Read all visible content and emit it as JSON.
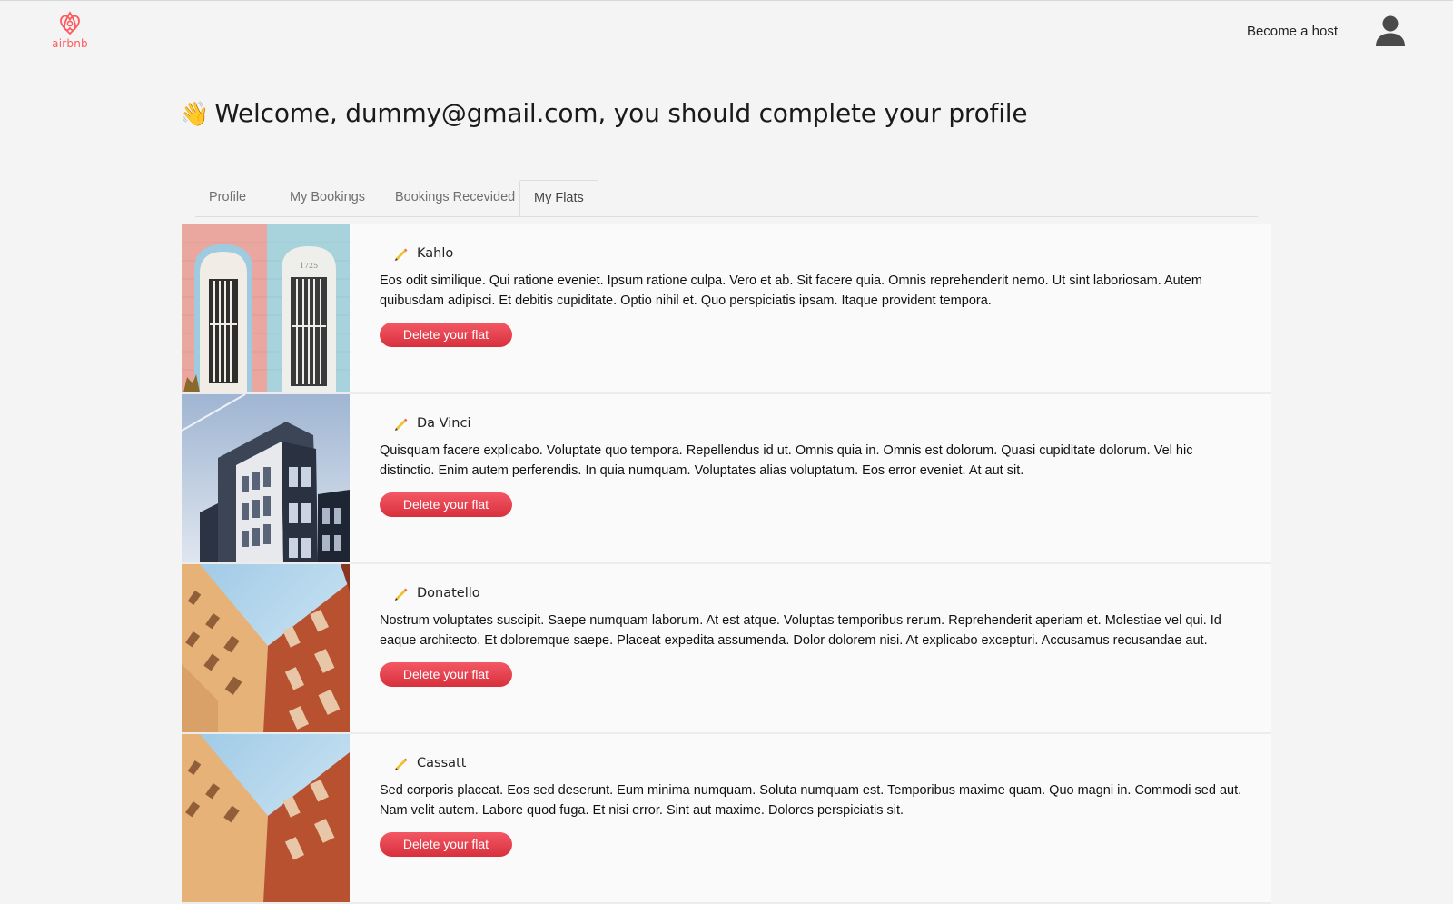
{
  "header": {
    "logo_text": "airbnb",
    "become_host": "Become a host",
    "brand_color": "#ff5a5f"
  },
  "welcome": {
    "emoji": "👋",
    "text": "Welcome, dummy@gmail.com, you should complete your profile"
  },
  "tabs": [
    {
      "label": "Profile",
      "active": false
    },
    {
      "label": "My Bookings",
      "active": false
    },
    {
      "label": "Bookings Recevided",
      "active": false
    },
    {
      "label": "My Flats",
      "active": true
    }
  ],
  "flats": [
    {
      "title": "Kahlo",
      "description": "Eos odit similique. Qui ratione eveniet. Ipsum ratione culpa. Vero et ab. Sit facere quia. Omnis reprehenderit nemo. Ut sint laboriosam. Autem quibusdam adipisci. Et debitis cupiditate. Optio nihil et. Quo perspiciatis ipsam. Itaque provident tempora.",
      "button": "Delete your flat",
      "image": "pastel-doors"
    },
    {
      "title": "Da Vinci",
      "description": "Quisquam facere explicabo. Voluptate quo tempora. Repellendus id ut. Omnis quia in. Omnis est dolorum. Quasi cupiditate dolorum. Vel hic distinctio. Enim autem perferendis. In quia numquam. Voluptates alias voluptatum. Eos error eveniet. At aut sit.",
      "button": "Delete your flat",
      "image": "modern-building"
    },
    {
      "title": "Donatello",
      "description": "Nostrum voluptates suscipit. Saepe numquam laborum. At est atque. Voluptas temporibus rerum. Reprehenderit aperiam et. Molestiae vel qui. Id eaque architecto. Et doloremque saepe. Placeat expedita assumenda. Dolor dolorem nisi. At explicabo excepturi. Accusamus recusandae aut.",
      "button": "Delete your flat",
      "image": "orange-buildings"
    },
    {
      "title": "Cassatt",
      "description": "Sed corporis placeat. Eos sed deserunt. Eum minima numquam. Soluta numquam est. Temporibus maxime quam. Quo magni in. Commodi sed aut. Nam velit autem. Labore quod fuga. Et nisi error. Sint aut maxime. Dolores perspiciatis sit.",
      "button": "Delete your flat",
      "image": "orange-buildings"
    }
  ]
}
